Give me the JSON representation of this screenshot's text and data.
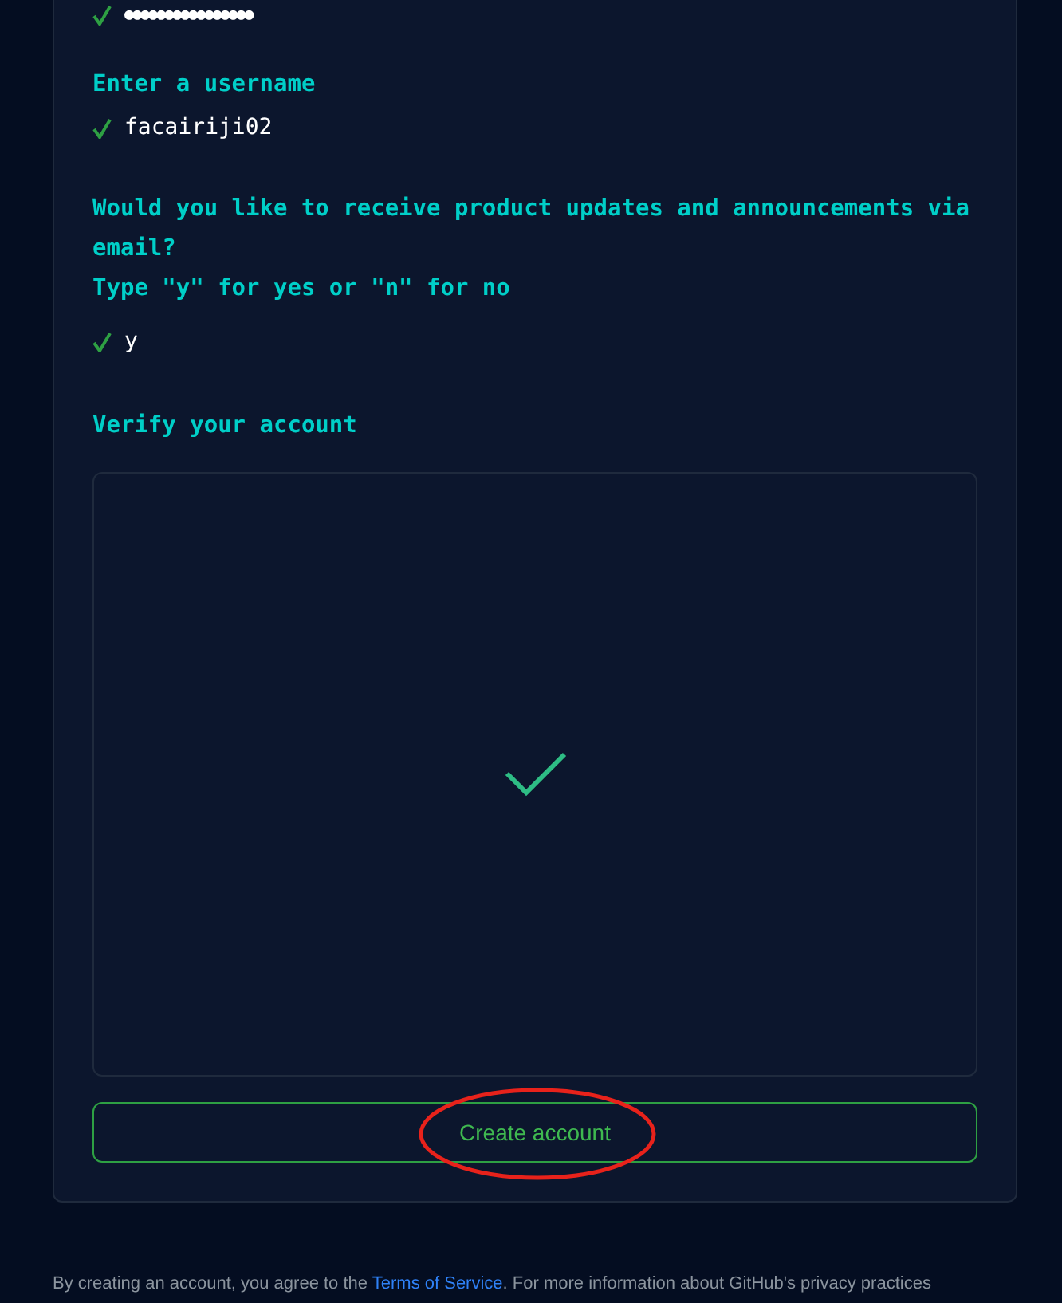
{
  "password": {
    "value": "●●●●●●●●●●●●●●●●",
    "valid": true
  },
  "steps": [
    {
      "prompt": "Enter a username",
      "value": "facairiji02",
      "valid": true
    },
    {
      "prompt": "Would you like to receive product updates and announcements via email?",
      "hint": "Type \"y\" for yes or \"n\" for no",
      "value": "y",
      "valid": true
    }
  ],
  "verify": {
    "title": "Verify your account",
    "verified": true
  },
  "button": {
    "label": "Create account",
    "circled": true
  },
  "footer": {
    "before": "By creating an account, you agree to the ",
    "link": "Terms of Service",
    "after": ". For more information about GitHub's privacy practices"
  }
}
